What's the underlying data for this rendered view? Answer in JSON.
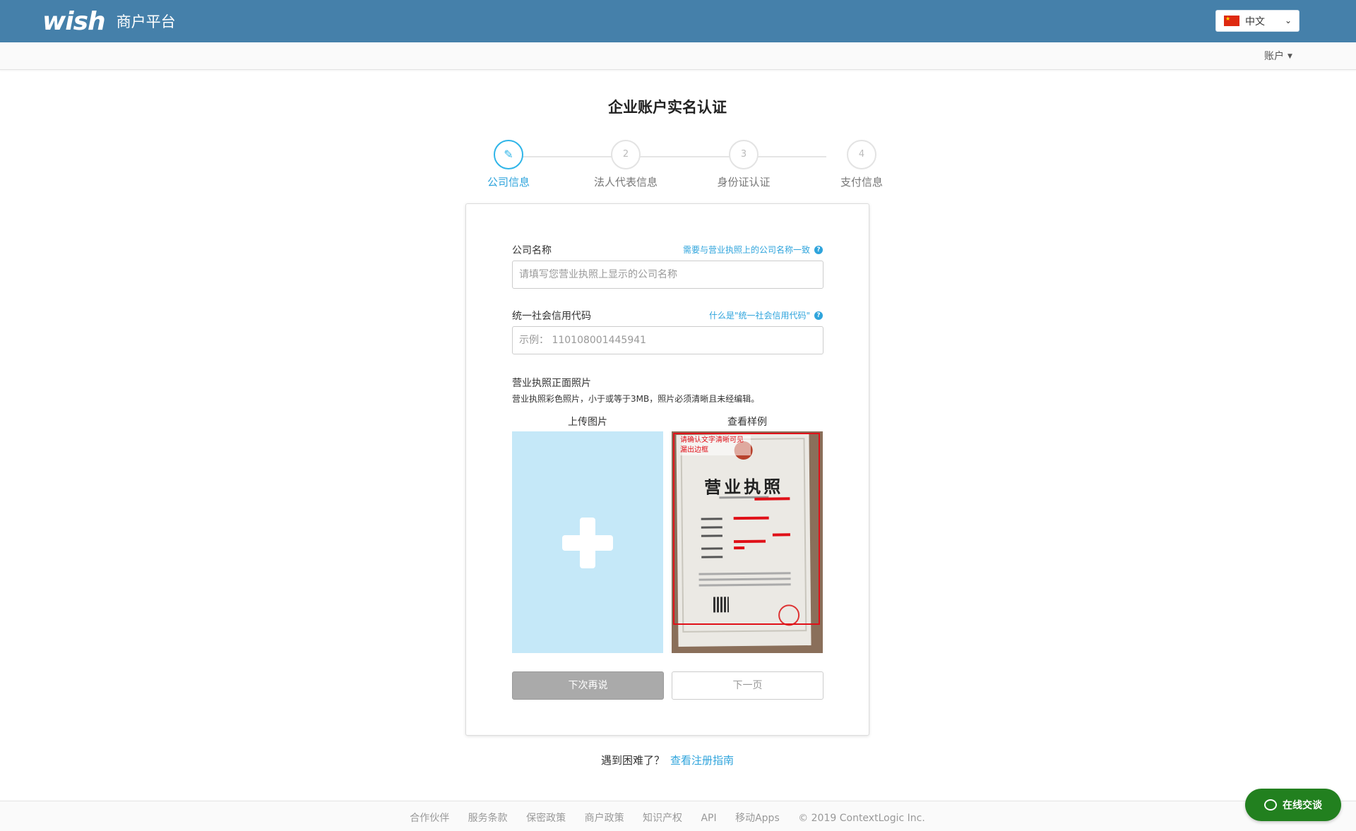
{
  "header": {
    "logo_text": "wish",
    "portal_name": "商户平台",
    "language": "中文"
  },
  "subbar": {
    "account_label": "账户"
  },
  "page_title": "企业账户实名认证",
  "steps": [
    {
      "number": "",
      "label": "公司信息",
      "active": true,
      "icon": "pencil-icon"
    },
    {
      "number": "2",
      "label": "法人代表信息",
      "active": false
    },
    {
      "number": "3",
      "label": "身份证认证",
      "active": false
    },
    {
      "number": "4",
      "label": "支付信息",
      "active": false
    }
  ],
  "form": {
    "company_name": {
      "label": "公司名称",
      "help": "需要与营业执照上的公司名称一致",
      "placeholder": "请填写您营业执照上显示的公司名称",
      "value": ""
    },
    "credit_code": {
      "label": "统一社会信用代码",
      "help": "什么是\"统一社会信用代码\"",
      "placeholder": "示例： 110108001445941",
      "value": ""
    },
    "license_photo": {
      "title": "营业执照正面照片",
      "hint": "营业执照彩色照片，小于或等于3MB，照片必须清晰且未经编辑。",
      "upload_heading": "上传图片",
      "sample_heading": "查看样例",
      "sample_note": "请确认文字清晰可见 漏出边框",
      "sample_title": "营业执照"
    },
    "later_button": "下次再说",
    "next_button": "下一页"
  },
  "help": {
    "question": "遇到困难了？",
    "link": "查看注册指南"
  },
  "footer": {
    "links": [
      "合作伙伴",
      "服务条款",
      "保密政策",
      "商户政策",
      "知识产权",
      "API",
      "移动Apps"
    ],
    "copyright": "© 2019 ContextLogic Inc."
  },
  "chat": {
    "label": "在线交谈"
  },
  "colors": {
    "header_bg": "#4580aa",
    "accent": "#2fa4dc",
    "upload_bg": "#c5e8f8",
    "chat_bg": "#22801f"
  }
}
